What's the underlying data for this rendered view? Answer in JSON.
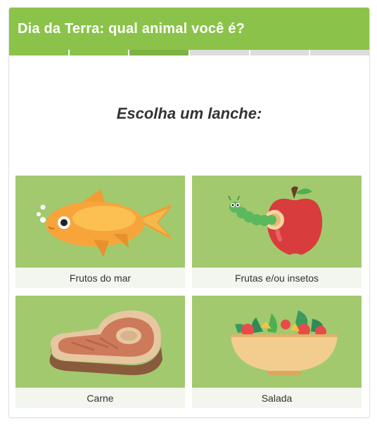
{
  "quiz": {
    "title": "Dia da Terra: qual animal você é?",
    "progress": {
      "total_steps": 6,
      "completed_steps": 2,
      "current_step": 3
    },
    "question": "Escolha um lanche:",
    "options": [
      {
        "label": "Frutos do mar",
        "icon": "fish-icon"
      },
      {
        "label": "Frutas e/ou insetos",
        "icon": "apple-worm-icon"
      },
      {
        "label": "Carne",
        "icon": "steak-icon"
      },
      {
        "label": "Salada",
        "icon": "salad-bowl-icon"
      }
    ]
  },
  "colors": {
    "header_green": "#8bc34a",
    "option_green": "#a2c96e",
    "label_bg": "#f2f6ee",
    "progress_gray": "#dddddd"
  }
}
